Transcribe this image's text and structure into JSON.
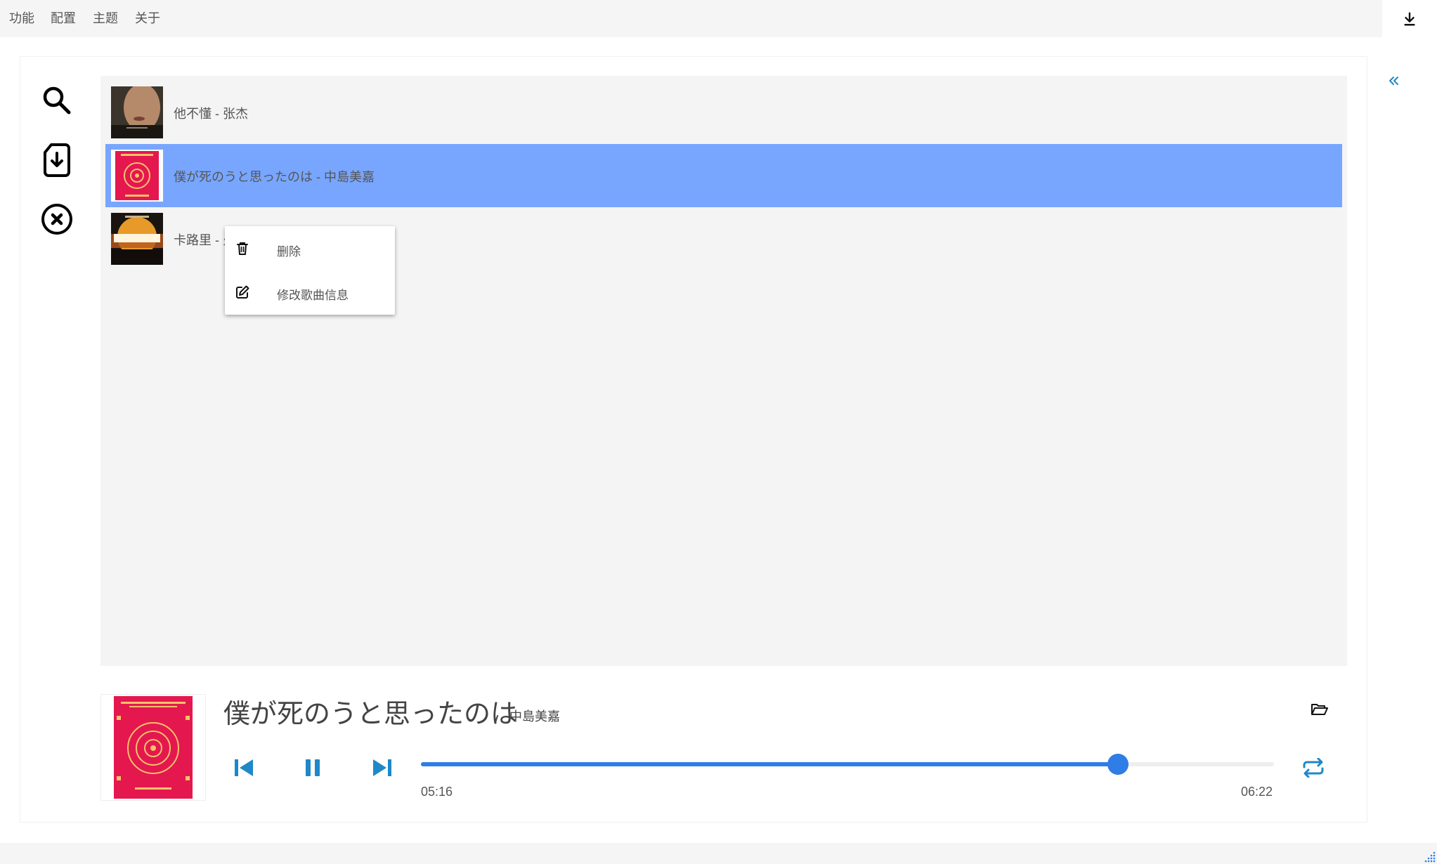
{
  "menubar": {
    "items": [
      "功能",
      "配置",
      "主题",
      "关于"
    ]
  },
  "sidebar_tools": [
    "search-icon",
    "import-file-icon",
    "close-circle-icon"
  ],
  "playlist": {
    "songs": [
      {
        "title": "他不懂 - 张杰",
        "selected": false
      },
      {
        "title": "僕が死のうと思ったのは - 中島美嘉",
        "selected": true
      },
      {
        "title": "卡路里 - 火箭少女101",
        "selected": false
      }
    ]
  },
  "context_menu": {
    "delete_label": "删除",
    "edit_label": "修改歌曲信息"
  },
  "player": {
    "title": "僕が死のうと思ったのは",
    "artist": "中島美嘉",
    "current_time": "05:16",
    "total_time": "06:22",
    "progress": 0.8168,
    "state": "playing"
  },
  "colors": {
    "accent": "#2f7de6",
    "selected_row": "#78a6ff",
    "icon_blue": "#1e88c8",
    "menubar_bg": "#f5f5f5",
    "playlist_bg": "#f4f4f4"
  }
}
